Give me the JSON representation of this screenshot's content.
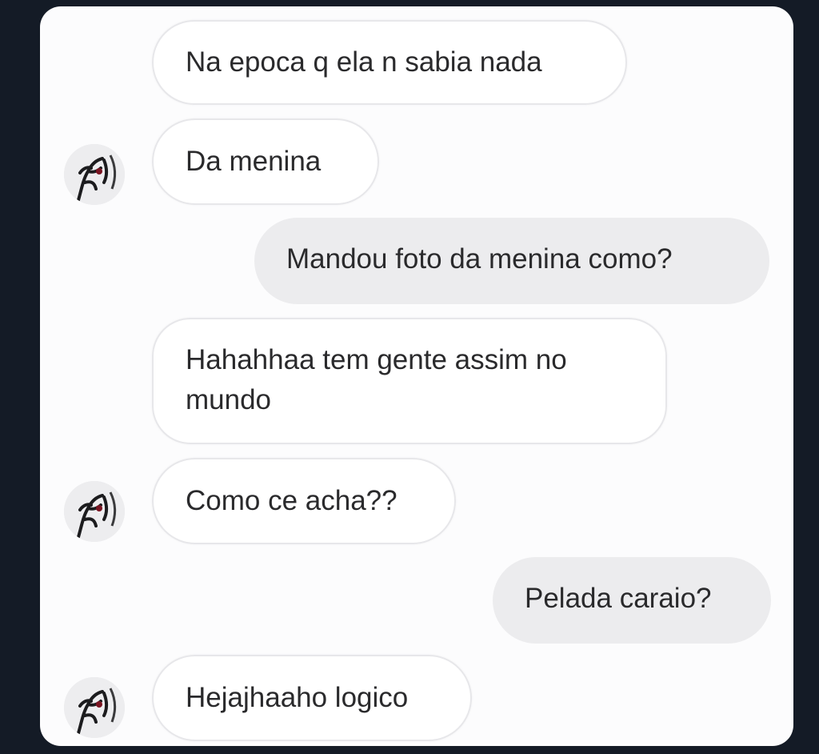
{
  "conversation": {
    "messages": [
      {
        "id": "m1",
        "direction": "incoming",
        "text": "Na epoca q ela n sabia nada",
        "avatar": false
      },
      {
        "id": "m2",
        "direction": "incoming",
        "text": "Da  menina",
        "avatar": true
      },
      {
        "id": "m3",
        "direction": "outgoing",
        "text": "Mandou foto da menina como?"
      },
      {
        "id": "m4",
        "direction": "incoming",
        "text": "Hahahhaa tem gente assim no mundo",
        "avatar": false
      },
      {
        "id": "m5",
        "direction": "incoming",
        "text": "Como ce acha??",
        "avatar": true
      },
      {
        "id": "m6",
        "direction": "outgoing",
        "text": "Pelada caraio?"
      },
      {
        "id": "m7",
        "direction": "incoming",
        "text": "Hejajhaaho logico",
        "avatar": true
      }
    ],
    "avatar_icon": "contact-avatar-icon"
  },
  "colors": {
    "page_background": "#141b26",
    "card_background": "#fcfcfd",
    "incoming_bubble": "#ffffff",
    "incoming_border": "#e7e7ea",
    "outgoing_bubble": "#ececee",
    "text": "#2a2a2c"
  }
}
